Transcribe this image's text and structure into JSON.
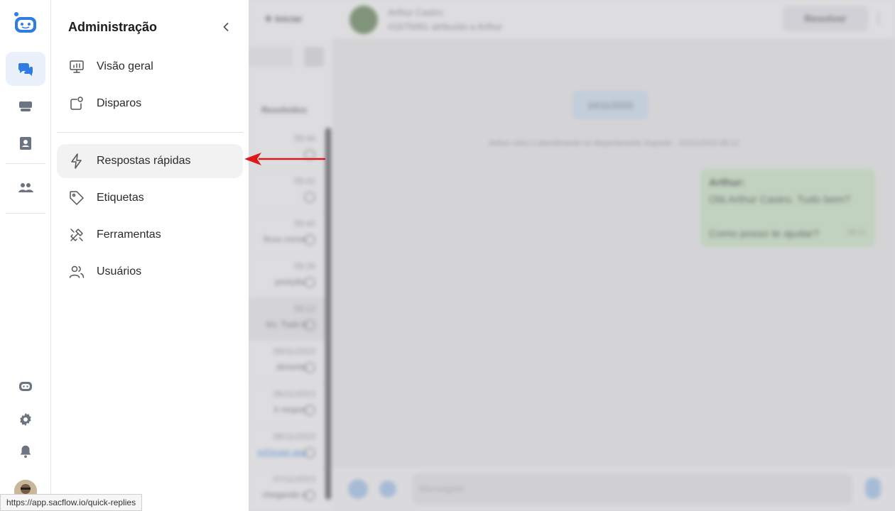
{
  "panel": {
    "title": "Administração",
    "items_top": [
      {
        "label": "Visão geral",
        "icon": "monitor-chart-icon"
      },
      {
        "label": "Disparos",
        "icon": "broadcast-icon"
      }
    ],
    "items_bottom": [
      {
        "label": "Respostas rápidas",
        "icon": "lightning-icon",
        "active": true
      },
      {
        "label": "Etiquetas",
        "icon": "tag-icon"
      },
      {
        "label": "Ferramentas",
        "icon": "tools-icon"
      },
      {
        "label": "Usuários",
        "icon": "users-icon"
      }
    ]
  },
  "background": {
    "iniciar": "Iniciar",
    "header_name": "Arthur Castro",
    "header_sub": "#1675061 atribuído a Arthur",
    "resolve": "Resolver",
    "tab_resolved": "Resolvidos",
    "date_pill": "10/11/2023",
    "system_line": "Arthur criou o atendimento no departamento Suporte - 10/11/2023 08:12",
    "bubble_author": "Arthur:",
    "bubble_line1": "Olá Arthur Castro. Tudo bem?",
    "bubble_line2": "Como posso te ajudar?",
    "bubble_time": "08:12",
    "composer_placeholder": "Mensagem",
    "list": [
      {
        "time": "09:44",
        "preview": ""
      },
      {
        "time": "09:42",
        "preview": ""
      },
      {
        "time": "09:40",
        "preview": "ficou conve"
      },
      {
        "time": "09:28",
        "preview": "posição."
      },
      {
        "time": "08:12",
        "preview": "tro. Tudo b"
      },
      {
        "time": "09/11/2023",
        "preview": "dimento"
      },
      {
        "time": "06/11/2023",
        "preview": "h respos"
      },
      {
        "time": "06/11/2023",
        "preview": "m/Grupo aqu"
      },
      {
        "time": "07/11/2023",
        "preview": "chegando n"
      }
    ]
  },
  "status_bar": {
    "url": "https://app.sacflow.io/quick-replies"
  },
  "colors": {
    "accent": "#2f7de1",
    "arrow": "#e0161b",
    "active_bg": "#f2f2f2"
  }
}
